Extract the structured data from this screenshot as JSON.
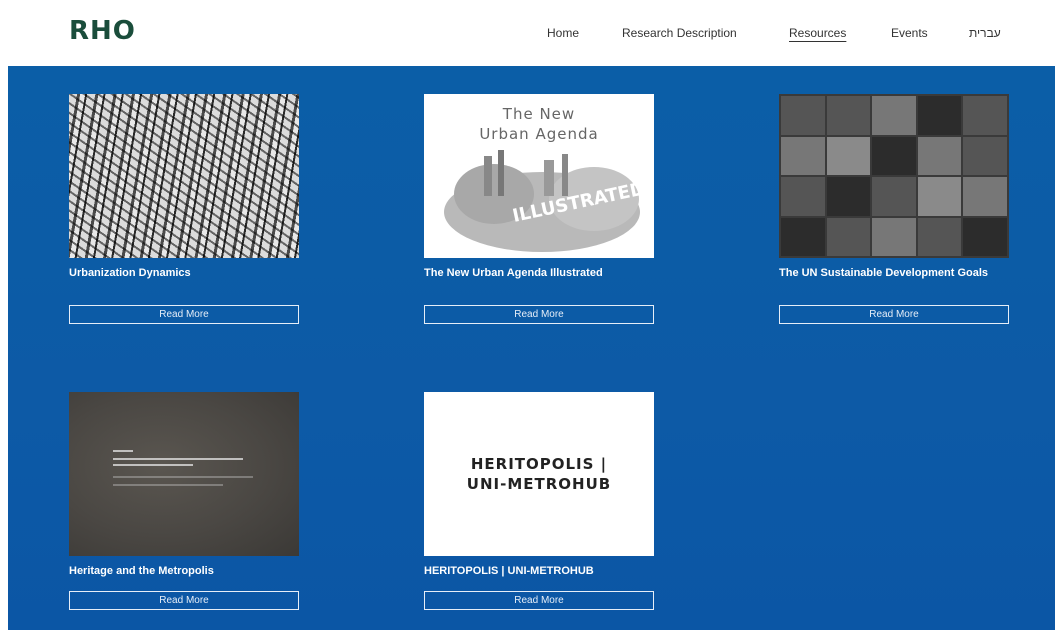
{
  "header": {
    "logo": "RHO",
    "nav": [
      {
        "label": "Home"
      },
      {
        "label": "Research Description"
      },
      {
        "label": "Resources",
        "active": true
      },
      {
        "label": "Events"
      },
      {
        "label": "עברית"
      }
    ]
  },
  "cards": [
    {
      "title": "Urbanization Dynamics",
      "button": "Read More"
    },
    {
      "title": "The New Urban Agenda Illustrated",
      "button": "Read More",
      "image_text": [
        "The New",
        "Urban Agenda"
      ]
    },
    {
      "title": "The UN Sustainable Development Goals",
      "button": "Read More"
    },
    {
      "title": "Heritage and the Metropolis",
      "button": "Read More"
    },
    {
      "title": "HERITOPOLIS | UNI-METROHUB",
      "button": "Read More",
      "image_text": [
        "HERITOPOLIS |",
        "UNI-METROHUB"
      ]
    }
  ],
  "colors": {
    "background": "#0b5ea7",
    "logo": "#1a4d3b"
  }
}
